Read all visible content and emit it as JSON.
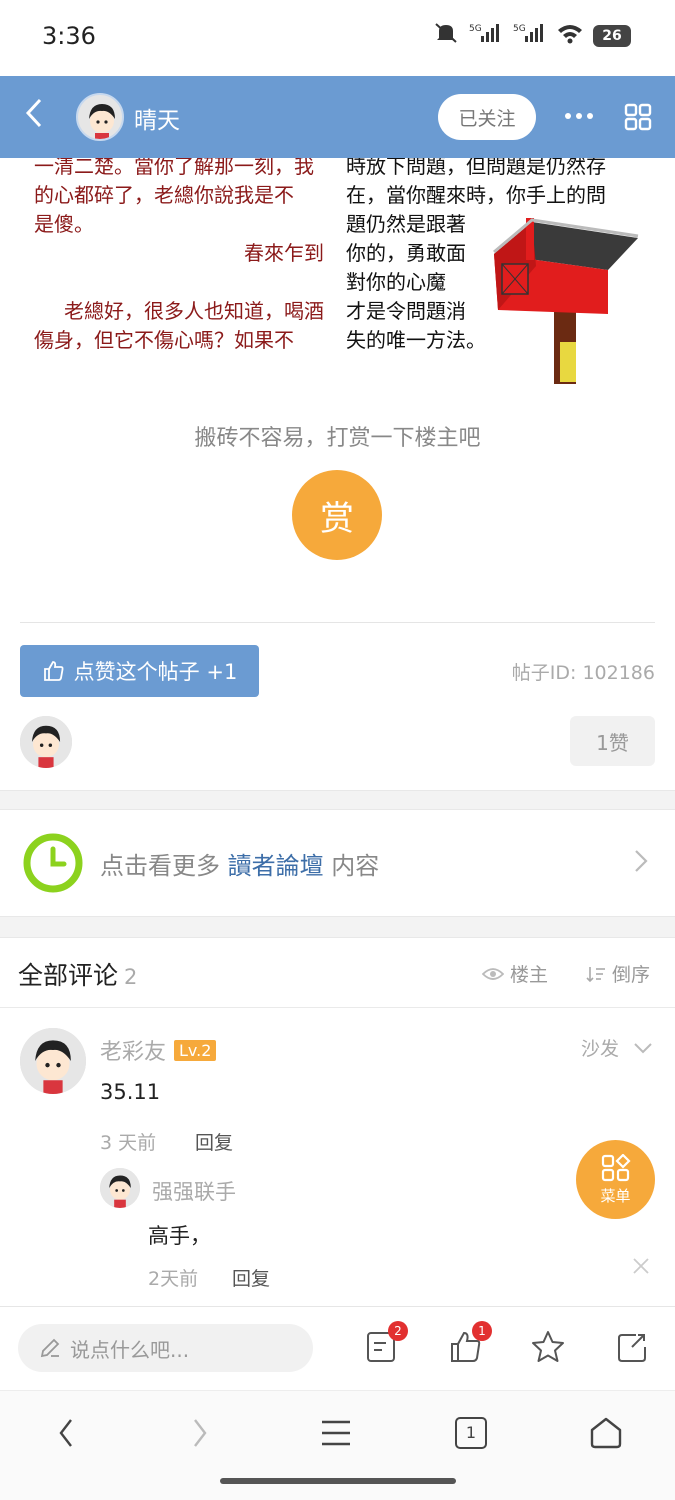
{
  "status_bar": {
    "time": "3:36",
    "battery": "26"
  },
  "header": {
    "username": "晴天",
    "follow_label": "已关注"
  },
  "post_image": {
    "left_lines": [
      "一清二楚。當你了解那一刻，我",
      "的心都碎了，老總你說我是不",
      "是傻。",
      "春來乍到",
      "",
      "老總好，很多人也知道，喝酒",
      "傷身，但它不傷心嗎？如果不"
    ],
    "right_lines": [
      "時放下問題，但問題是仍然存",
      "在，當你醒來時，你手上的問",
      "題仍然是跟著",
      "你的，勇敢面",
      "對你的心魔",
      "才是令問題消",
      "失的唯一方法。"
    ]
  },
  "reward": {
    "tip": "搬砖不容易，打赏一下楼主吧",
    "button": "赏"
  },
  "like_bar": {
    "button": "点赞这个帖子 +1",
    "post_id": "帖子ID: 102186",
    "like_count": "1赞"
  },
  "more": {
    "prefix": "点击看更多",
    "forum": "讀者論壇",
    "suffix": "内容"
  },
  "comments": {
    "title": "全部评论",
    "count": "2",
    "filter_owner": "楼主",
    "filter_order": "倒序",
    "items": [
      {
        "name": "老彩友",
        "level": "Lv.2",
        "floor": "沙发",
        "content": "35.11",
        "time": "3 天前",
        "reply_label": "回复",
        "replies": [
          {
            "name": "强强联手",
            "content": "高手，",
            "time": "2天前",
            "reply_label": "回复"
          }
        ]
      }
    ]
  },
  "fab": {
    "label": "菜单"
  },
  "bottom_bar": {
    "placeholder": "说点什么吧...",
    "comment_badge": "2",
    "like_badge": "1"
  },
  "nav": {
    "tab_count": "1"
  },
  "colors": {
    "header_blue": "#6b9bd2",
    "accent_orange": "#f6a93b",
    "link_blue": "#3d6ea8"
  }
}
